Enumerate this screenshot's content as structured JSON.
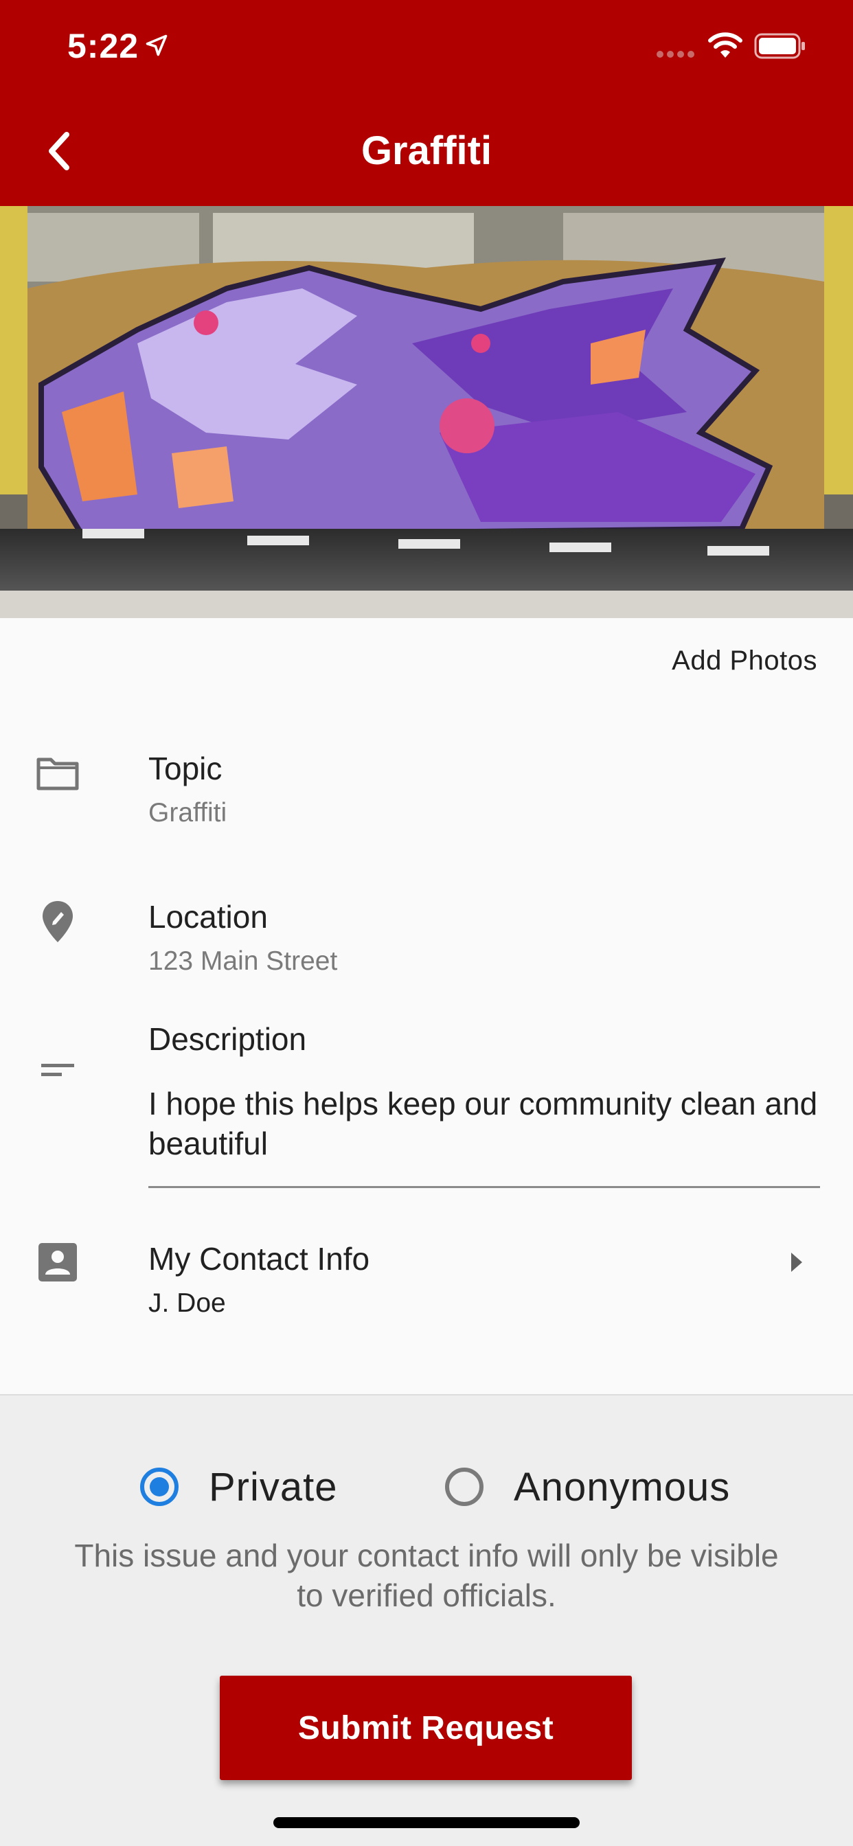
{
  "status_bar": {
    "time": "5:22"
  },
  "nav": {
    "title": "Graffiti"
  },
  "photo": {
    "alt": "graffiti photo"
  },
  "add_photos_label": "Add Photos",
  "topic": {
    "title": "Topic",
    "value": "Graffiti",
    "icon": "folder-icon"
  },
  "location": {
    "title": "Location",
    "value": "123 Main Street",
    "icon": "location-pin-icon"
  },
  "description": {
    "title": "Description",
    "value": "I hope this helps keep our community clean and beautiful",
    "icon": "notes-icon"
  },
  "contact": {
    "title": "My Contact Info",
    "value": "J. Doe",
    "icon": "contact-card-icon"
  },
  "privacy": {
    "options": [
      "Private",
      "Anonymous"
    ],
    "selected": "Private",
    "note": "This issue and your contact info will only be visible to verified officials."
  },
  "submit_label": "Submit Request",
  "colors": {
    "brand": "#b00000",
    "radio_selected": "#1e7fe0"
  }
}
